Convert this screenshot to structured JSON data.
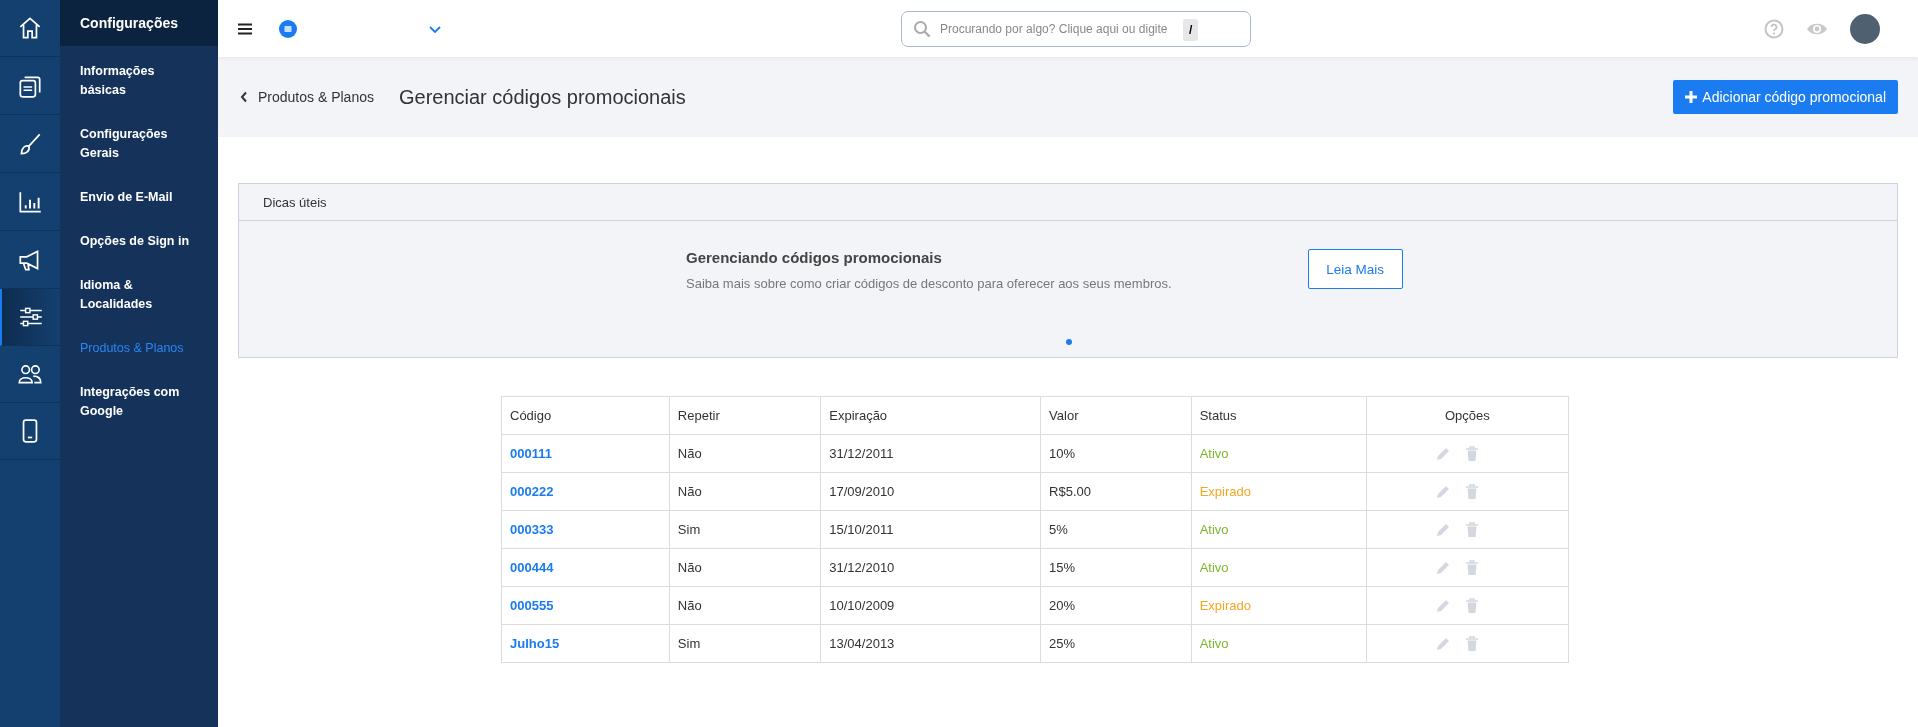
{
  "rail": [
    {
      "selected": false
    },
    {
      "selected": false
    },
    {
      "selected": false
    },
    {
      "selected": false
    },
    {
      "selected": false
    },
    {
      "selected": true
    },
    {
      "selected": false
    },
    {
      "selected": false
    }
  ],
  "sidebar": {
    "title": "Configurações",
    "items": [
      {
        "label": "Informações básicas",
        "selected": false
      },
      {
        "label": "Configurações Gerais",
        "selected": false
      },
      {
        "label": "Envio de E-Mail",
        "selected": false
      },
      {
        "label": "Opções de Sign in",
        "selected": false
      },
      {
        "label": "Idioma & Localidades",
        "selected": false
      },
      {
        "label": "Produtos & Planos",
        "selected": true
      },
      {
        "label": "Integrações com Google",
        "selected": false
      }
    ]
  },
  "topbar": {
    "search": {
      "placeholder": "Procurando por algo? Clique aqui ou digite",
      "shortcut": "/"
    }
  },
  "header": {
    "back": "Produtos & Planos",
    "title": "Gerenciar códigos promocionais",
    "add_button": "Adicionar código promocional"
  },
  "tips": {
    "title": "Dicas úteis",
    "heading": "Gerenciando códigos promocionais",
    "text": "Saiba mais sobre como criar códigos de desconto para oferecer aos seus membros.",
    "button": "Leia Mais"
  },
  "table": {
    "columns": [
      "Código",
      "Repetir",
      "Expiração",
      "Valor",
      "Status",
      "Opções"
    ],
    "rows": [
      {
        "code": "000111",
        "repeat": "Não",
        "expiration": "31/12/2011",
        "value": "10%",
        "status": "Ativo",
        "color": "#7cb82f"
      },
      {
        "code": "000222",
        "repeat": "Não",
        "expiration": "17/09/2010",
        "value": "R$5.00",
        "status": "Expirado",
        "color": "#f5a623"
      },
      {
        "code": "000333",
        "repeat": "Sim",
        "expiration": "15/10/2011",
        "value": "5%",
        "status": "Ativo",
        "color": "#7cb82f"
      },
      {
        "code": "000444",
        "repeat": "Não",
        "expiration": "31/12/2010",
        "value": "15%",
        "status": "Ativo",
        "color": "#7cb82f"
      },
      {
        "code": "000555",
        "repeat": "Não",
        "expiration": "10/10/2009",
        "value": "20%",
        "status": "Expirado",
        "color": "#f5a623"
      },
      {
        "code": "Julho15",
        "repeat": "Sim",
        "expiration": "13/04/2013",
        "value": "25%",
        "status": "Ativo",
        "color": "#7cb82f"
      }
    ]
  }
}
